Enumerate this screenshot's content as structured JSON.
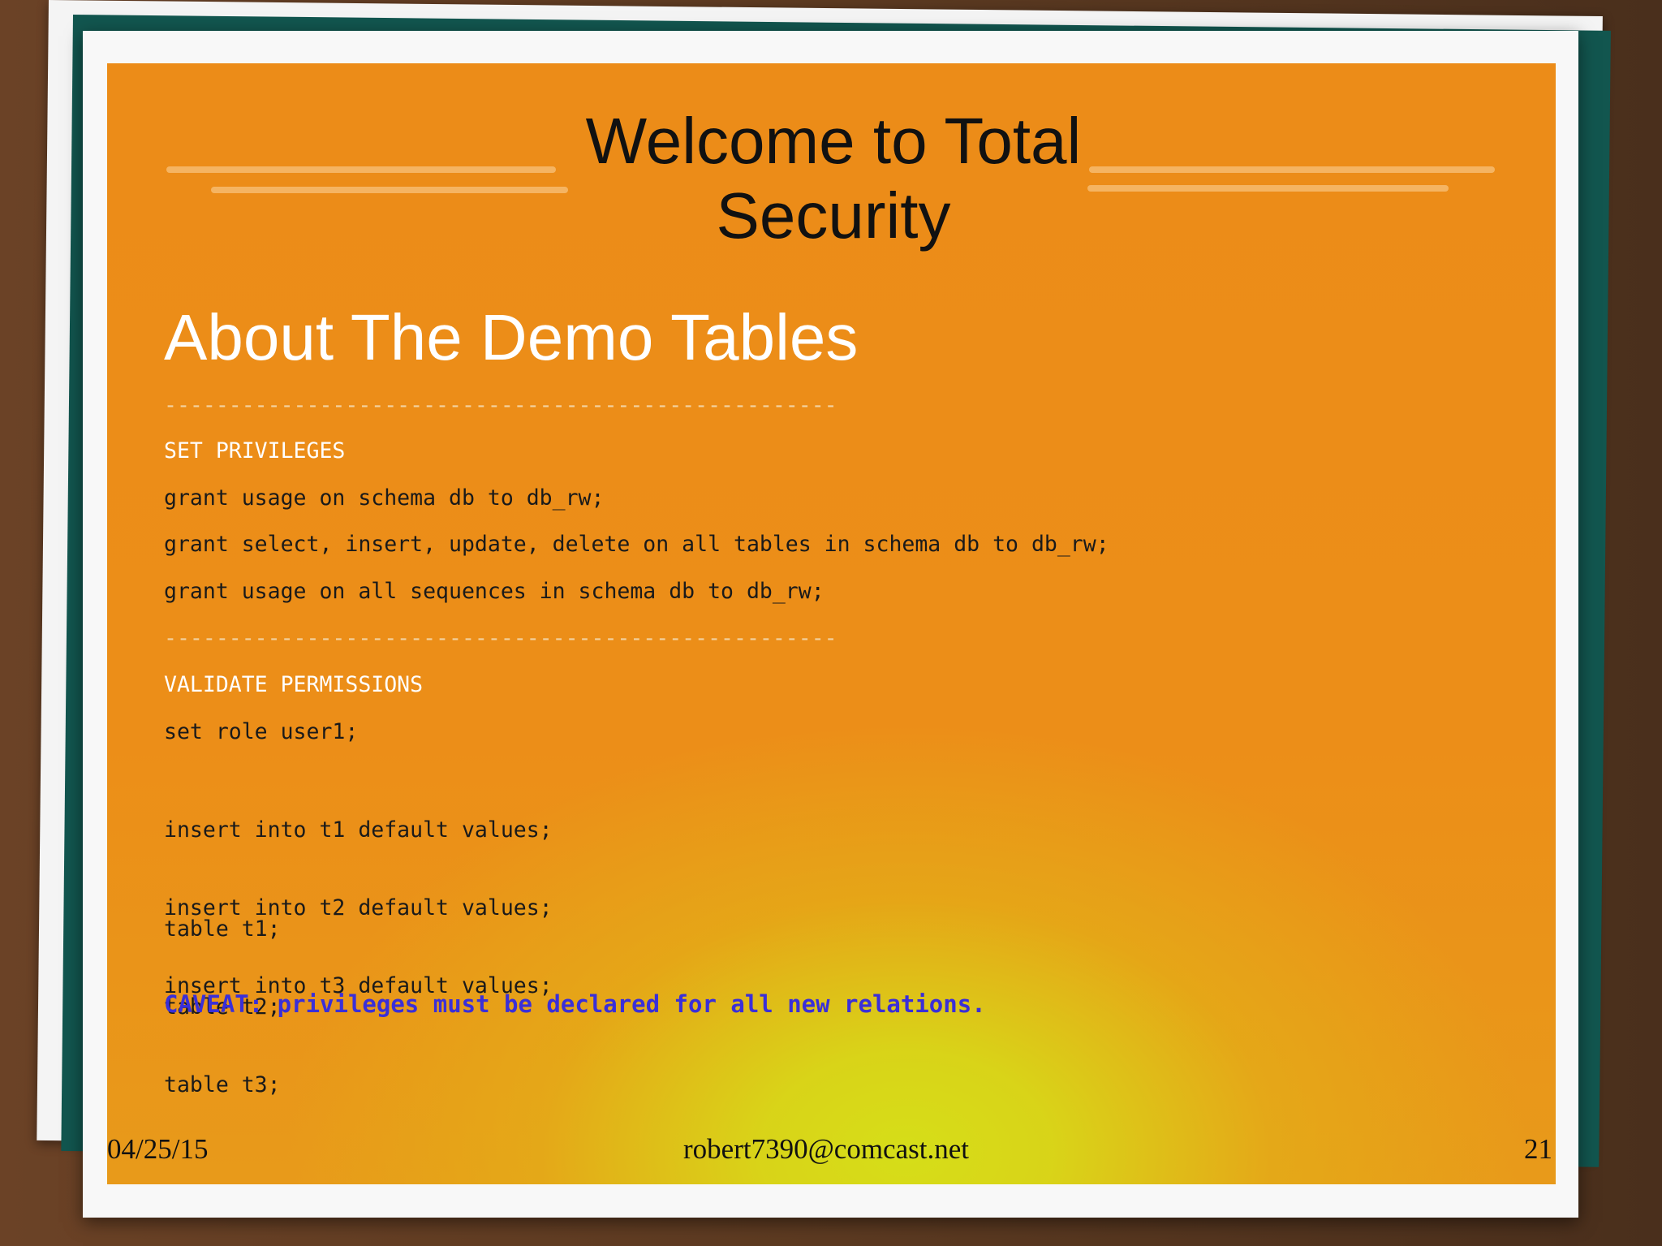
{
  "slide": {
    "title": "Welcome to Total\nSecurity",
    "subtitle": "About The Demo Tables",
    "separator": "----------------------------------------------------",
    "section1": {
      "heading": "SET PRIVILEGES",
      "lines": [
        "grant usage on schema db to db_rw;",
        "grant select, insert, update, delete on all tables in schema db to db_rw;",
        "grant usage on all sequences in schema db to db_rw;"
      ]
    },
    "section2": {
      "heading": "VALIDATE PERMISSIONS",
      "set_role": "set role user1;",
      "inserts": [
        "insert into t1 default values;",
        "insert into t2 default values;",
        "insert into t3 default values;"
      ],
      "tables": [
        "table t1;",
        "table t2;",
        "table t3;"
      ]
    },
    "caveat": "CAVEAT: privileges must be declared for all new relations.",
    "footer": {
      "date": "04/25/15",
      "email": "robert7390@comcast.net",
      "page_number": "21"
    }
  },
  "colors": {
    "background_orange": "#ec8c18",
    "center_glow": "#d6de18",
    "caveat_blue": "#3a2fd8",
    "teal_layer": "#12564f",
    "wood_frame": "#6b4226"
  }
}
